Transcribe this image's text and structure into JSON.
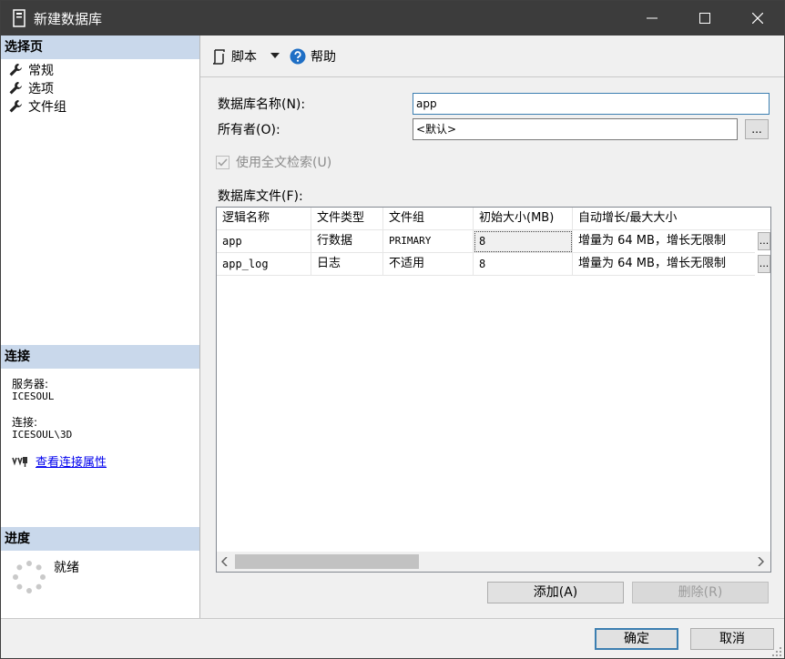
{
  "window": {
    "title": "新建数据库"
  },
  "sidebar": {
    "select_page_header": "选择页",
    "pages": [
      "常规",
      "选项",
      "文件组"
    ],
    "connection_header": "连接",
    "server_label": "服务器:",
    "server_value": "ICESOUL",
    "connection_label": "连接:",
    "connection_value": "ICESOUL\\3D",
    "view_props_link": "查看连接属性",
    "progress_header": "进度",
    "progress_status": "就绪"
  },
  "toolbar": {
    "script_label": "脚本",
    "help_label": "帮助"
  },
  "form": {
    "db_name_label": "数据库名称(N):",
    "db_name_value": "app",
    "owner_label": "所有者(O):",
    "owner_value": "<默认>",
    "browse_label": "...",
    "fulltext_label": "使用全文检索(U)",
    "files_label": "数据库文件(F):"
  },
  "grid": {
    "columns": [
      "逻辑名称",
      "文件类型",
      "文件组",
      "初始大小(MB)",
      "自动增长/最大大小"
    ],
    "rows": [
      [
        "app",
        "行数据",
        "PRIMARY",
        "8",
        "增量为 64 MB，增长无限制"
      ],
      [
        "app_log",
        "日志",
        "不适用",
        "8",
        "增量为 64 MB，增长无限制"
      ]
    ],
    "cell_button_label": "..."
  },
  "buttons": {
    "add": "添加(A)",
    "remove": "删除(R)",
    "ok": "确定",
    "cancel": "取消"
  },
  "colors": {
    "titlebar": "#3c3c3c",
    "section_header": "#c9d8eb",
    "link": "#0000ee",
    "help_icon": "#1f6fc5",
    "accent": "#3c7fb1"
  }
}
